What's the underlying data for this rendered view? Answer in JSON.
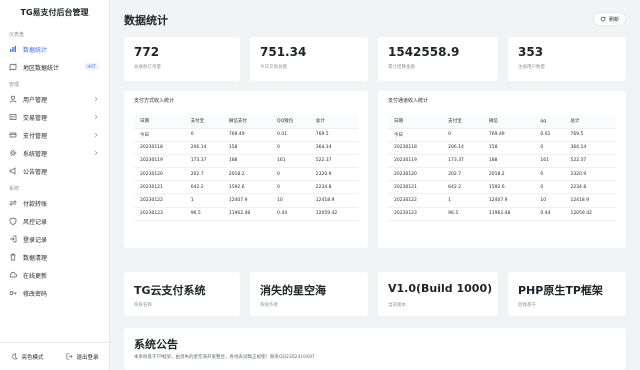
{
  "app": {
    "title": "TG易支付后台管理"
  },
  "sidebar": {
    "sections": [
      "仪表盘",
      "管理",
      "系统"
    ],
    "items": [
      {
        "label": "数据统计",
        "icon": "bar-chart-icon",
        "active": true
      },
      {
        "label": "地区数据统计",
        "icon": "map-icon",
        "tag": "HOT"
      },
      {
        "label": "用户管理",
        "icon": "user-icon"
      },
      {
        "label": "交易管理",
        "icon": "transaction-icon"
      },
      {
        "label": "支付管理",
        "icon": "payment-icon"
      },
      {
        "label": "系统管理",
        "icon": "settings-icon"
      },
      {
        "label": "公告管理",
        "icon": "megaphone-icon"
      },
      {
        "label": "付款转账",
        "icon": "transfer-icon"
      },
      {
        "label": "风控记录",
        "icon": "shield-icon"
      },
      {
        "label": "登录记录",
        "icon": "login-icon"
      },
      {
        "label": "数据清理",
        "icon": "trash-icon"
      },
      {
        "label": "在线更新",
        "icon": "cloud-icon"
      },
      {
        "label": "修改密码",
        "icon": "key-icon"
      }
    ],
    "footer": {
      "theme": "亮色模式",
      "logout": "退出登录"
    }
  },
  "header": {
    "title": "数据统计",
    "refresh": "刷新"
  },
  "stats": [
    {
      "value": "772",
      "label": "总收款订单量"
    },
    {
      "value": "751.34",
      "label": "今日交易总额"
    },
    {
      "value": "1542558.9",
      "label": "累计结算金额"
    },
    {
      "value": "353",
      "label": "注册用户数量"
    }
  ],
  "tables": [
    {
      "title": "支付方式收入统计",
      "headers": [
        "日期",
        "支付宝",
        "微信支付",
        "QQ钱包",
        "总计"
      ],
      "rows": [
        [
          "今日",
          "0",
          "769.49",
          "0.01",
          "769.5"
        ],
        [
          "20230118",
          "206.14",
          "158",
          "0",
          "364.14"
        ],
        [
          "20230119",
          "173.37",
          "188",
          "161",
          "522.37"
        ],
        [
          "20230120",
          "202.7",
          "2018.2",
          "0",
          "2320.9"
        ],
        [
          "20230121",
          "642.2",
          "1592.6",
          "0",
          "2234.8"
        ],
        [
          "20230122",
          "1",
          "12407.9",
          "10",
          "12418.9"
        ],
        [
          "20230123",
          "96.5",
          "11962.48",
          "0.44",
          "12059.42"
        ]
      ]
    },
    {
      "title": "支付通道收入统计",
      "headers": [
        "日期",
        "支付宝",
        "微信",
        "qq",
        "总计"
      ],
      "rows": [
        [
          "今日",
          "0",
          "769.49",
          "0.01",
          "769.5"
        ],
        [
          "20230118",
          "206.14",
          "158",
          "0",
          "364.14"
        ],
        [
          "20230119",
          "173.37",
          "188",
          "161",
          "522.37"
        ],
        [
          "20230120",
          "202.7",
          "2018.2",
          "0",
          "2320.9"
        ],
        [
          "20230121",
          "642.2",
          "1592.6",
          "0",
          "2234.8"
        ],
        [
          "20230122",
          "1",
          "12407.9",
          "10",
          "12418.9"
        ],
        [
          "20230123",
          "96.5",
          "11962.48",
          "0.44",
          "12059.42"
        ]
      ]
    }
  ],
  "info": [
    {
      "value": "TG云支付系统",
      "label": "系统名称"
    },
    {
      "value": "消失的星空海",
      "label": "系统作者"
    },
    {
      "value": "V1.0(Build 1000)",
      "label": "当前版本"
    },
    {
      "value": "PHP原生TP框架",
      "label": "后端基于"
    }
  ],
  "notice": {
    "title": "系统公告",
    "text": "本系统基于TP框架，由消失的星空海开发整合，各地表试稿正规使！联系QQ2302410497"
  }
}
